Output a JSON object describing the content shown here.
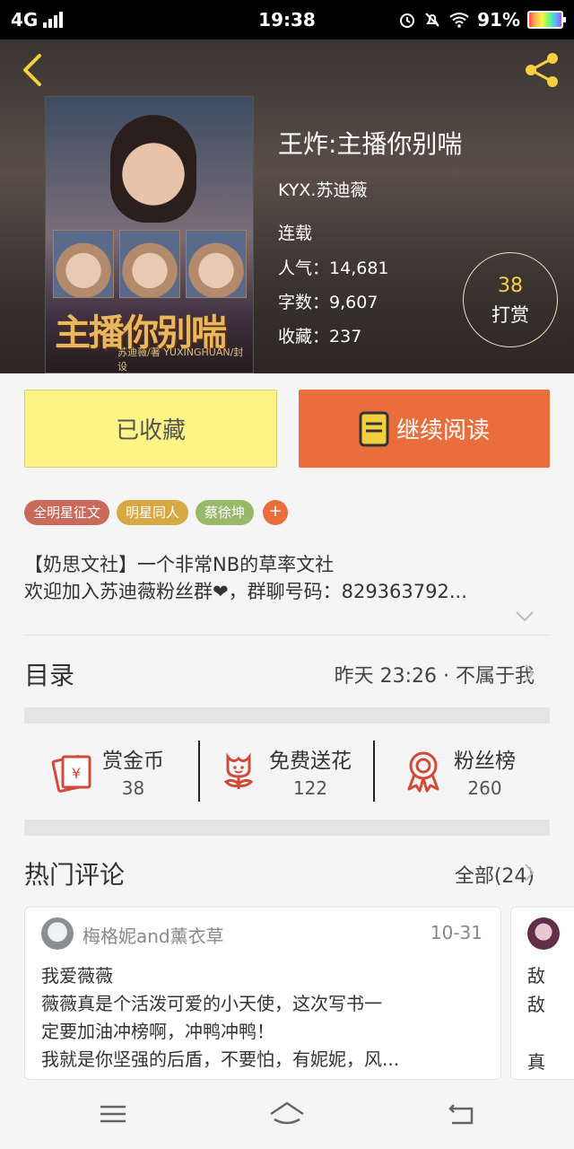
{
  "status_bar": {
    "network": "4G",
    "time": "19:38",
    "battery": "91%"
  },
  "book": {
    "title": "王炸:主播你别喘",
    "author": "KYX.苏迪薇",
    "status": "连载",
    "popularity_label": "人气：",
    "popularity": "14,681",
    "words_label": "字数：",
    "words": "9,607",
    "favorites_label": "收藏：",
    "favorites": "237",
    "cover_title": "主播你别喘",
    "cover_sub": "苏迪薇/著 YUXINGHUAN/封设"
  },
  "tip": {
    "count": "38",
    "label": "打赏"
  },
  "buttons": {
    "collected": "已收藏",
    "continue_reading": "继续阅读"
  },
  "tags": [
    {
      "label": "全明星征文",
      "color": "#c96a5a"
    },
    {
      "label": "明星同人",
      "color": "#d8a845"
    },
    {
      "label": "蔡徐坤",
      "color": "#9ab86a"
    }
  ],
  "tag_add": "+",
  "description": {
    "line1": "【奶思文社】一个非常NB的草率文社",
    "line2": "欢迎加入苏迪薇粉丝群❤，群聊号码：829363792..."
  },
  "toc": {
    "title": "目录",
    "meta": "昨天 23:26 · 不属于我"
  },
  "actions": [
    {
      "label": "赏金币",
      "value": "38",
      "icon": "red-envelope-icon"
    },
    {
      "label": "免费送花",
      "value": "122",
      "icon": "flower-icon"
    },
    {
      "label": "粉丝榜",
      "value": "260",
      "icon": "ribbon-award-icon"
    }
  ],
  "hot_comments": {
    "title": "热门评论",
    "all_label": "全部(24)",
    "comments": [
      {
        "user": "梅格妮and薰衣草",
        "date": "10-31",
        "title": "我爱薇薇",
        "body": [
          "薇薇真是个活泼可爱的小天使，这次写书一",
          "定要加油冲榜啊，冲鸭冲鸭！",
          "我就是你坚强的后盾，不要怕，有妮妮，风..."
        ]
      },
      {
        "lines": [
          "敌",
          "敌",
          "真"
        ]
      }
    ]
  },
  "colors": {
    "accent_orange": "#ea6d3c",
    "collected_yellow": "#fff486",
    "tip_gold": "#f4d03f",
    "icon_red": "#d24a3a"
  }
}
